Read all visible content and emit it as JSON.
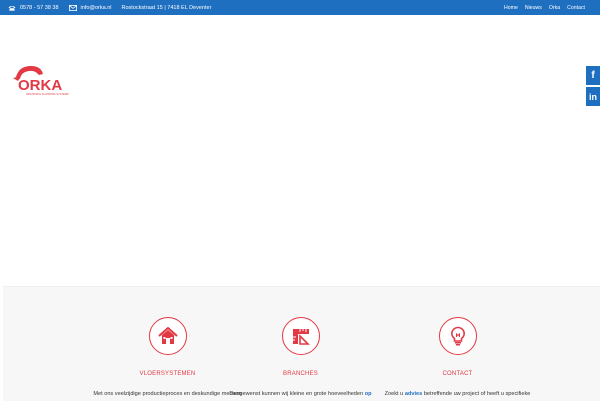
{
  "topbar": {
    "phone": "0578 - 57 38 38",
    "email": "info@orka.nl",
    "address": "Rostockstraat 15 | 7418 EL Deventer",
    "nav": [
      "Home",
      "Nieuws",
      "Orka",
      "Contact"
    ]
  },
  "logo": {
    "name": "ORKA",
    "tagline": "INDUSTRIAL FLOORING SYSTEMS"
  },
  "social": {
    "facebook": "f",
    "linkedin": "in"
  },
  "features": [
    {
      "title": "VLOERSYSTEMEN",
      "text": "Met ons veelzijdige productieproces en deskundige mensen",
      "icon": "house-icon"
    },
    {
      "title": "BRANCHES",
      "text_before": "Desgewenst kunnen wij kleine en grote hoeveelheden",
      "text_link": "op",
      "icon": "ruler-icon"
    },
    {
      "title": "CONTACT",
      "text_before": "Zoekt u",
      "text_link": "advies",
      "text_after": "betreffende uw project of heeft u specifieke",
      "icon": "lightbulb-icon"
    }
  ],
  "colors": {
    "brand_blue": "#1f6fc0",
    "accent_red": "#e23944",
    "band_bg": "#f7f7f7"
  }
}
